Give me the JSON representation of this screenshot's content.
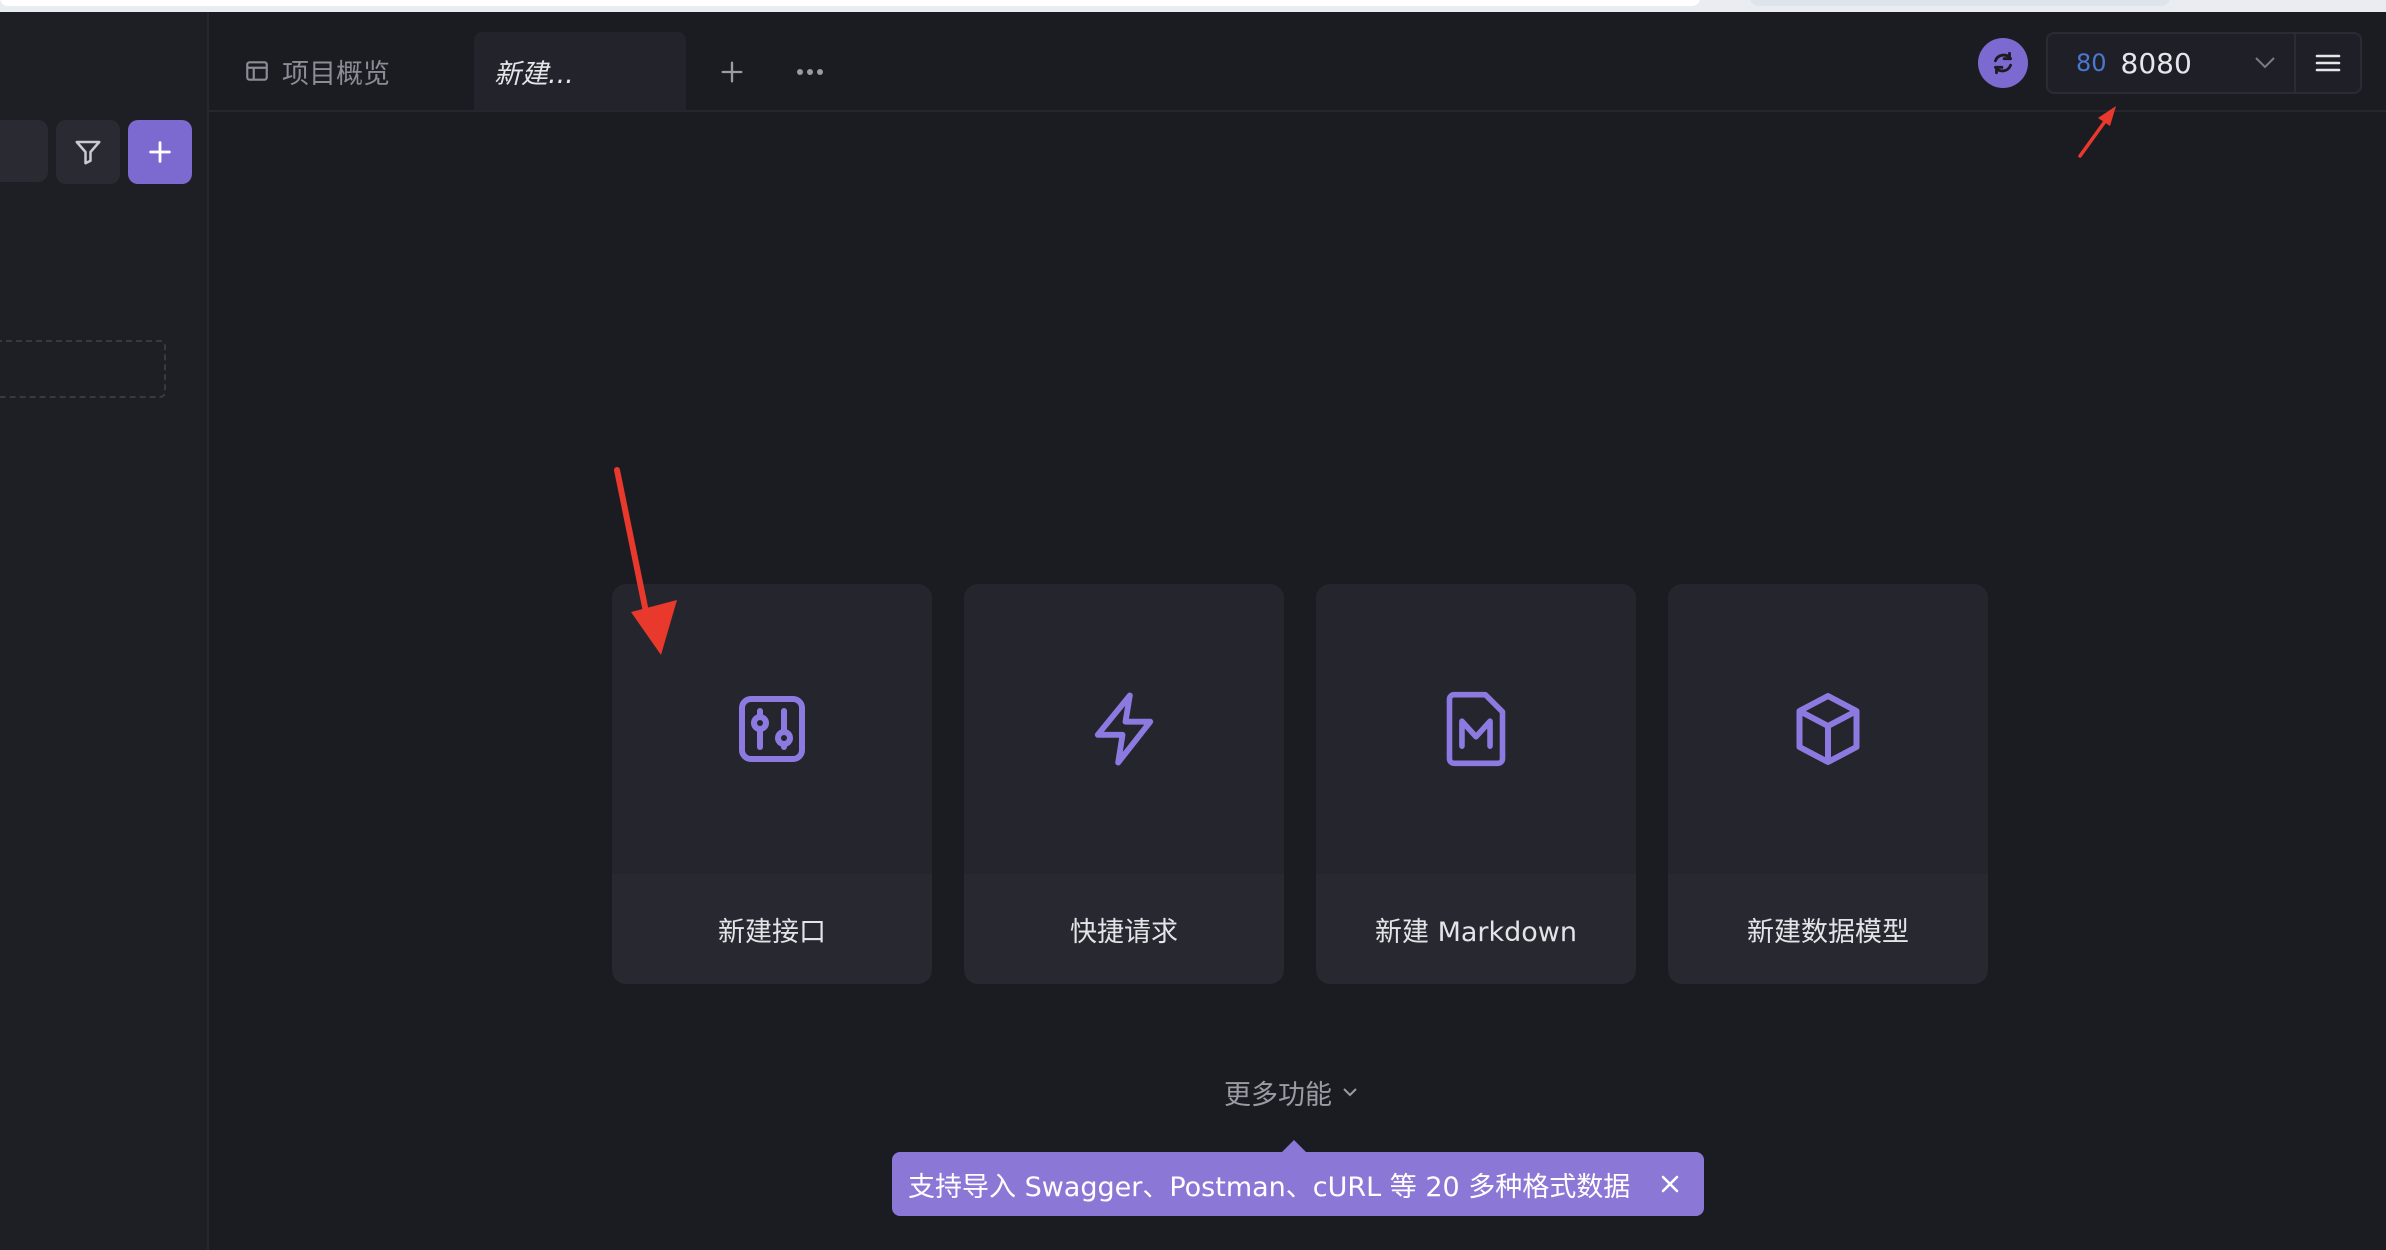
{
  "colors": {
    "background": "#1b1c22",
    "accent": "#7d6ad0",
    "tooltip_bg": "#8b78d6",
    "card_bg": "#24252d",
    "annotation_red": "#e8392c",
    "env_badge": "#4a78d0"
  },
  "tabs": [
    {
      "label": "项目概览",
      "icon": "layout-icon",
      "active": false
    },
    {
      "label": "新建...",
      "active": true
    }
  ],
  "tab_actions": {
    "add_icon": "plus-icon",
    "more_icon": "ellipsis-icon"
  },
  "toolbar": {
    "sync_icon": "sync-icon",
    "env_badge": "80",
    "env_value": "8080",
    "env_chevron": "chevron-down-icon",
    "menu_icon": "hamburger-menu-icon"
  },
  "sidebar": {
    "filter_icon": "filter-icon",
    "add_icon": "plus-icon"
  },
  "cards": [
    {
      "label": "新建接口",
      "icon": "api-icon"
    },
    {
      "label": "快捷请求",
      "icon": "lightning-icon"
    },
    {
      "label": "新建 Markdown",
      "icon": "markdown-file-icon"
    },
    {
      "label": "新建数据模型",
      "icon": "cube-icon"
    }
  ],
  "more_features": {
    "label": "更多功能",
    "icon": "chevron-down-icon"
  },
  "tooltip": {
    "text": "支持导入 Swagger、Postman、cURL 等 20 多种格式数据",
    "close_icon": "close-icon"
  }
}
